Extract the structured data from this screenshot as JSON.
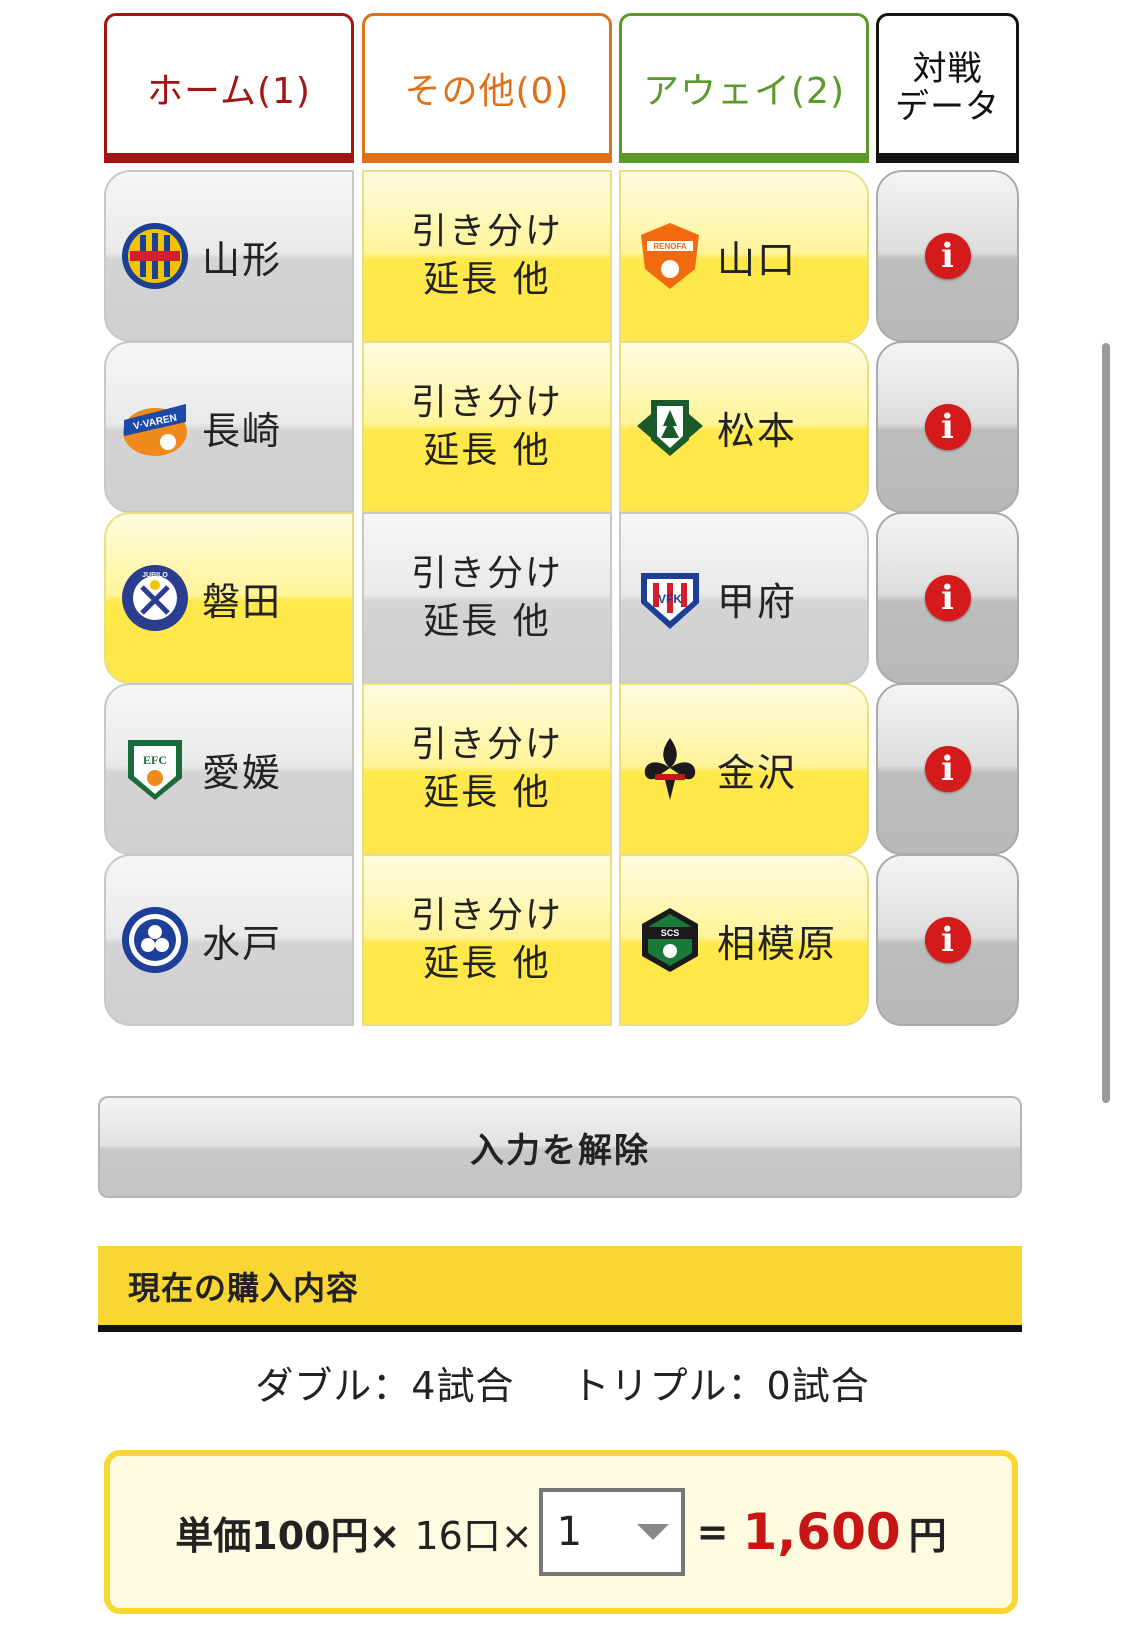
{
  "header": {
    "home": "ホーム(1)",
    "other": "その他(0)",
    "away": "アウェイ(2)",
    "data": "対戦\nデータ"
  },
  "matches": [
    {
      "home": "山形",
      "middle": "引き分け\n延長 他",
      "away": "山口"
    },
    {
      "home": "長崎",
      "middle": "引き分け\n延長 他",
      "away": "松本"
    },
    {
      "home": "磐田",
      "middle": "引き分け\n延長 他",
      "away": "甲府"
    },
    {
      "home": "愛媛",
      "middle": "引き分け\n延長 他",
      "away": "金沢"
    },
    {
      "home": "水戸",
      "middle": "引き分け\n延長 他",
      "away": "相模原"
    }
  ],
  "clear_button": "入力を解除",
  "purchase": {
    "title": "現在の購入内容",
    "double": "ダブル：4試合",
    "triple": "トリプル：0試合",
    "unit_price": "単価100円×",
    "units": "16口×",
    "multiplier": "1",
    "equals": "=",
    "total": "1,600",
    "yen": "円"
  },
  "colors": {
    "home": "#a31515",
    "other": "#e0701a",
    "away": "#5a9a2a",
    "selected": "#ffe84a",
    "accent": "#fad634",
    "total": "#c81616"
  },
  "logo_lettering": {
    "yamaguchi": "RENOFA",
    "nagasaki": "V·VAREN",
    "iwata": "JUBILO",
    "kofu": "VFK",
    "ehime": "EFC",
    "sagamihara": "SCS"
  }
}
